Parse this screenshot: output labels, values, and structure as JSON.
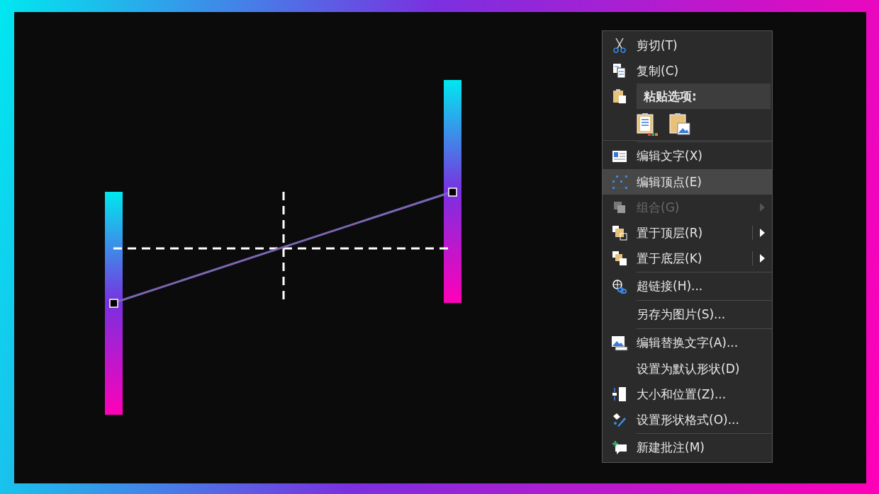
{
  "context_menu": {
    "items": [
      {
        "kind": "item",
        "label": "剪切(T)",
        "selected": false,
        "disabled": false,
        "submenu": false,
        "divider_above": false
      },
      {
        "kind": "item",
        "label": "复制(C)",
        "selected": false,
        "disabled": false,
        "submenu": false,
        "divider_above": false
      },
      {
        "kind": "heading",
        "label": "粘贴选项:"
      },
      {
        "kind": "paste-options"
      },
      {
        "kind": "item",
        "label": "编辑文字(X)",
        "selected": false,
        "disabled": false,
        "submenu": false,
        "divider_above": true
      },
      {
        "kind": "item",
        "label": "编辑顶点(E)",
        "selected": true,
        "disabled": false,
        "submenu": false,
        "divider_above": false
      },
      {
        "kind": "item",
        "label": "组合(G)",
        "selected": false,
        "disabled": true,
        "submenu": true,
        "divider_above": false
      },
      {
        "kind": "item",
        "label": "置于顶层(R)",
        "selected": false,
        "disabled": false,
        "submenu": true,
        "divider_above": false
      },
      {
        "kind": "item",
        "label": "置于底层(K)",
        "selected": false,
        "disabled": false,
        "submenu": true,
        "divider_above": false
      },
      {
        "kind": "item",
        "label": "超链接(H)...",
        "selected": false,
        "disabled": false,
        "submenu": false,
        "divider_above": true
      },
      {
        "kind": "item",
        "label": "另存为图片(S)...",
        "selected": false,
        "disabled": false,
        "submenu": false,
        "divider_above": true
      },
      {
        "kind": "item",
        "label": "编辑替换文字(A)...",
        "selected": false,
        "disabled": false,
        "submenu": false,
        "divider_above": true
      },
      {
        "kind": "item",
        "label": "设置为默认形状(D)",
        "selected": false,
        "disabled": false,
        "submenu": false,
        "divider_above": false
      },
      {
        "kind": "item",
        "label": "大小和位置(Z)...",
        "selected": false,
        "disabled": false,
        "submenu": false,
        "divider_above": false
      },
      {
        "kind": "item",
        "label": "设置形状格式(O)...",
        "selected": false,
        "disabled": false,
        "submenu": false,
        "divider_above": false
      },
      {
        "kind": "item",
        "label": "新建批注(M)",
        "selected": false,
        "disabled": false,
        "submenu": false,
        "divider_above": true
      }
    ]
  }
}
